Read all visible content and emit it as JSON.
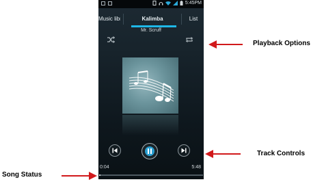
{
  "status_bar": {
    "time": "5:45PM"
  },
  "tabs": {
    "left": "Music libr",
    "center": "Kalimba",
    "right": "List"
  },
  "track": {
    "artist": "Mr. Scruff"
  },
  "progress": {
    "elapsed": "0:04",
    "duration": "5:48",
    "fraction": 0.012
  },
  "annotations": {
    "playback_options": "Playback Options",
    "track_controls": "Track Controls",
    "song_status": "Song Status"
  },
  "colors": {
    "accent": "#1fb8e8",
    "arrow": "#d1191b"
  },
  "icons": [
    "shuffle-icon",
    "repeat-icon",
    "previous-icon",
    "pause-icon",
    "next-icon",
    "music-notes-icon"
  ]
}
